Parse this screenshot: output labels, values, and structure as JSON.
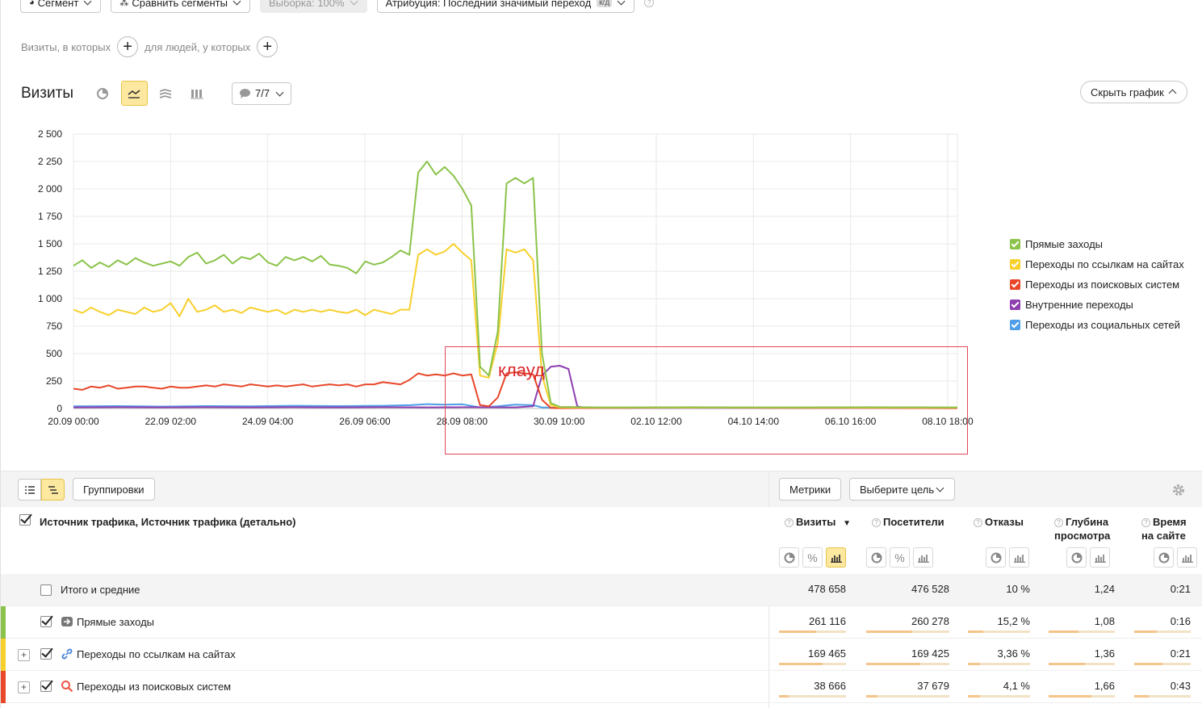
{
  "toolbar": {
    "segment": "Сегмент",
    "compare": "Сравнить сегменты",
    "sample": "Выборка: 100%",
    "attribution": "Атрибуция: Последний значимый переход",
    "attribution_badge": "к/д"
  },
  "segment_builder": {
    "visits_where": "Визиты, в которых",
    "people_where": "для людей, у которых"
  },
  "chart_header": {
    "title": "Визиты",
    "annotations": "7/7",
    "hide_chart": "Скрыть график"
  },
  "annotation": {
    "label": "клауд"
  },
  "colors": {
    "direct": "#8bc34a",
    "links": "#f7d02c",
    "search": "#e8472a",
    "internal": "#8e3fb0",
    "social": "#4f9ee8"
  },
  "chart_data": {
    "type": "line",
    "x_ticks": [
      "20.09 00:00",
      "22.09 02:00",
      "24.09 04:00",
      "26.09 06:00",
      "28.09 08:00",
      "30.09 10:00",
      "02.10 12:00",
      "04.10 14:00",
      "06.10 16:00",
      "08.10 18:00"
    ],
    "y_ticks": [
      "0",
      "250",
      "500",
      "750",
      "1 000",
      "1 250",
      "1 500",
      "1 750",
      "2 000",
      "2 250",
      "2 500"
    ],
    "ylim": [
      0,
      2500
    ],
    "grid": true,
    "legend_position": "right",
    "x_index_range": [
      0,
      100
    ],
    "series": [
      {
        "name": "Прямые заходы",
        "color": "#8bc34a",
        "points": [
          [
            0,
            1300
          ],
          [
            1,
            1350
          ],
          [
            2,
            1280
          ],
          [
            3,
            1330
          ],
          [
            4,
            1290
          ],
          [
            5,
            1350
          ],
          [
            6,
            1310
          ],
          [
            7,
            1370
          ],
          [
            8,
            1330
          ],
          [
            9,
            1300
          ],
          [
            10,
            1320
          ],
          [
            11,
            1340
          ],
          [
            12,
            1300
          ],
          [
            13,
            1380
          ],
          [
            14,
            1420
          ],
          [
            15,
            1320
          ],
          [
            16,
            1350
          ],
          [
            17,
            1400
          ],
          [
            18,
            1320
          ],
          [
            19,
            1380
          ],
          [
            20,
            1360
          ],
          [
            21,
            1410
          ],
          [
            22,
            1330
          ],
          [
            23,
            1300
          ],
          [
            24,
            1380
          ],
          [
            25,
            1350
          ],
          [
            26,
            1380
          ],
          [
            27,
            1340
          ],
          [
            28,
            1390
          ],
          [
            29,
            1310
          ],
          [
            30,
            1300
          ],
          [
            31,
            1280
          ],
          [
            32,
            1230
          ],
          [
            33,
            1340
          ],
          [
            34,
            1310
          ],
          [
            35,
            1330
          ],
          [
            36,
            1380
          ],
          [
            37,
            1440
          ],
          [
            38,
            1400
          ],
          [
            39,
            2150
          ],
          [
            40,
            2250
          ],
          [
            41,
            2130
          ],
          [
            42,
            2200
          ],
          [
            43,
            2120
          ],
          [
            44,
            2000
          ],
          [
            45,
            1850
          ],
          [
            46,
            380
          ],
          [
            47,
            300
          ],
          [
            48,
            700
          ],
          [
            49,
            2050
          ],
          [
            50,
            2100
          ],
          [
            51,
            2050
          ],
          [
            52,
            2100
          ],
          [
            53,
            500
          ],
          [
            54,
            50
          ],
          [
            55,
            15
          ],
          [
            60,
            10
          ],
          [
            70,
            12
          ],
          [
            80,
            10
          ],
          [
            90,
            12
          ],
          [
            100,
            10
          ]
        ]
      },
      {
        "name": "Переходы по ссылкам на сайтах",
        "color": "#f7d02c",
        "points": [
          [
            0,
            900
          ],
          [
            1,
            870
          ],
          [
            2,
            920
          ],
          [
            3,
            880
          ],
          [
            4,
            850
          ],
          [
            5,
            900
          ],
          [
            6,
            880
          ],
          [
            7,
            860
          ],
          [
            8,
            920
          ],
          [
            9,
            880
          ],
          [
            10,
            900
          ],
          [
            11,
            960
          ],
          [
            12,
            840
          ],
          [
            13,
            1000
          ],
          [
            14,
            880
          ],
          [
            15,
            900
          ],
          [
            16,
            940
          ],
          [
            17,
            880
          ],
          [
            18,
            900
          ],
          [
            19,
            870
          ],
          [
            20,
            920
          ],
          [
            21,
            900
          ],
          [
            22,
            880
          ],
          [
            23,
            900
          ],
          [
            24,
            860
          ],
          [
            25,
            900
          ],
          [
            26,
            880
          ],
          [
            27,
            900
          ],
          [
            28,
            880
          ],
          [
            29,
            900
          ],
          [
            30,
            880
          ],
          [
            31,
            870
          ],
          [
            32,
            900
          ],
          [
            33,
            850
          ],
          [
            34,
            900
          ],
          [
            35,
            880
          ],
          [
            36,
            860
          ],
          [
            37,
            900
          ],
          [
            38,
            900
          ],
          [
            39,
            1400
          ],
          [
            40,
            1450
          ],
          [
            41,
            1400
          ],
          [
            42,
            1430
          ],
          [
            43,
            1500
          ],
          [
            44,
            1420
          ],
          [
            45,
            1350
          ],
          [
            46,
            300
          ],
          [
            47,
            280
          ],
          [
            48,
            600
          ],
          [
            49,
            1450
          ],
          [
            50,
            1420
          ],
          [
            51,
            1450
          ],
          [
            52,
            1350
          ],
          [
            53,
            300
          ],
          [
            54,
            30
          ],
          [
            55,
            10
          ],
          [
            60,
            8
          ],
          [
            70,
            8
          ],
          [
            80,
            8
          ],
          [
            90,
            8
          ],
          [
            100,
            8
          ]
        ]
      },
      {
        "name": "Переходы из поисковых систем",
        "color": "#e8472a",
        "points": [
          [
            0,
            180
          ],
          [
            1,
            170
          ],
          [
            2,
            200
          ],
          [
            3,
            190
          ],
          [
            4,
            210
          ],
          [
            5,
            180
          ],
          [
            6,
            190
          ],
          [
            7,
            200
          ],
          [
            8,
            200
          ],
          [
            9,
            190
          ],
          [
            10,
            180
          ],
          [
            11,
            200
          ],
          [
            12,
            190
          ],
          [
            13,
            190
          ],
          [
            14,
            200
          ],
          [
            15,
            210
          ],
          [
            16,
            200
          ],
          [
            17,
            220
          ],
          [
            18,
            210
          ],
          [
            19,
            200
          ],
          [
            20,
            220
          ],
          [
            21,
            210
          ],
          [
            22,
            200
          ],
          [
            23,
            210
          ],
          [
            24,
            200
          ],
          [
            25,
            210
          ],
          [
            26,
            220
          ],
          [
            27,
            200
          ],
          [
            28,
            210
          ],
          [
            29,
            220
          ],
          [
            30,
            210
          ],
          [
            31,
            220
          ],
          [
            32,
            200
          ],
          [
            33,
            220
          ],
          [
            34,
            220
          ],
          [
            35,
            240
          ],
          [
            36,
            230
          ],
          [
            37,
            220
          ],
          [
            38,
            260
          ],
          [
            39,
            320
          ],
          [
            40,
            300
          ],
          [
            41,
            310
          ],
          [
            42,
            300
          ],
          [
            43,
            320
          ],
          [
            44,
            300
          ],
          [
            45,
            310
          ],
          [
            46,
            30
          ],
          [
            47,
            20
          ],
          [
            48,
            100
          ],
          [
            49,
            320
          ],
          [
            50,
            330
          ],
          [
            51,
            320
          ],
          [
            52,
            310
          ],
          [
            53,
            80
          ],
          [
            54,
            5
          ],
          [
            55,
            3
          ],
          [
            60,
            5
          ],
          [
            70,
            8
          ],
          [
            80,
            5
          ],
          [
            90,
            5
          ],
          [
            100,
            3
          ]
        ]
      },
      {
        "name": "Внутренние переходы",
        "color": "#8e3fb0",
        "points": [
          [
            0,
            10
          ],
          [
            5,
            12
          ],
          [
            10,
            10
          ],
          [
            15,
            12
          ],
          [
            20,
            10
          ],
          [
            25,
            12
          ],
          [
            30,
            10
          ],
          [
            35,
            12
          ],
          [
            40,
            10
          ],
          [
            45,
            12
          ],
          [
            50,
            10
          ],
          [
            52,
            20
          ],
          [
            53,
            300
          ],
          [
            54,
            380
          ],
          [
            55,
            390
          ],
          [
            56,
            360
          ],
          [
            57,
            20
          ],
          [
            58,
            5
          ],
          [
            60,
            5
          ],
          [
            70,
            5
          ],
          [
            80,
            5
          ],
          [
            90,
            5
          ],
          [
            100,
            5
          ]
        ]
      },
      {
        "name": "Переходы из социальных сетей",
        "color": "#4f9ee8",
        "points": [
          [
            0,
            20
          ],
          [
            5,
            22
          ],
          [
            10,
            18
          ],
          [
            15,
            22
          ],
          [
            20,
            20
          ],
          [
            25,
            25
          ],
          [
            30,
            22
          ],
          [
            35,
            25
          ],
          [
            38,
            30
          ],
          [
            40,
            40
          ],
          [
            42,
            35
          ],
          [
            44,
            38
          ],
          [
            46,
            10
          ],
          [
            48,
            20
          ],
          [
            50,
            35
          ],
          [
            52,
            30
          ],
          [
            53,
            10
          ],
          [
            55,
            5
          ],
          [
            60,
            5
          ],
          [
            70,
            5
          ],
          [
            80,
            5
          ],
          [
            90,
            5
          ],
          [
            100,
            5
          ]
        ]
      }
    ]
  },
  "table": {
    "toolbar": {
      "groupings": "Группировки",
      "metrics": "Метрики",
      "goal": "Выберите цель"
    },
    "dimension_title": "Источник трафика, Источник трафика (детально)",
    "metrics": [
      {
        "line1": "Визиты",
        "line2": "",
        "sort": "▼"
      },
      {
        "line1": "Посетители",
        "line2": "",
        "sort": ""
      },
      {
        "line1": "Отказы",
        "line2": "",
        "sort": ""
      },
      {
        "line1": "Глубина",
        "line2": "просмотра",
        "sort": ""
      },
      {
        "line1": "Время",
        "line2": "на сайте",
        "sort": ""
      }
    ],
    "total": {
      "label": "Итого и средние",
      "values": [
        "478 658",
        "476 528",
        "10 %",
        "1,24",
        "0:21"
      ]
    },
    "rows": [
      {
        "label": "Прямые заходы",
        "values": [
          "261 116",
          "260 278",
          "15,2 %",
          "1,08",
          "0:16"
        ],
        "shares": [
          0.55,
          0.55,
          0.25,
          0.45,
          0.4
        ]
      },
      {
        "label": "Переходы по ссылкам на сайтах",
        "values": [
          "169 465",
          "169 425",
          "3,36 %",
          "1,36",
          "0:21"
        ],
        "shares": [
          0.65,
          0.65,
          0.2,
          0.55,
          0.5
        ]
      },
      {
        "label": "Переходы из поисковых систем",
        "values": [
          "38 666",
          "37 679",
          "4,1 %",
          "1,66",
          "0:43"
        ],
        "shares": [
          0.15,
          0.14,
          0.2,
          0.65,
          0.25
        ]
      }
    ]
  }
}
